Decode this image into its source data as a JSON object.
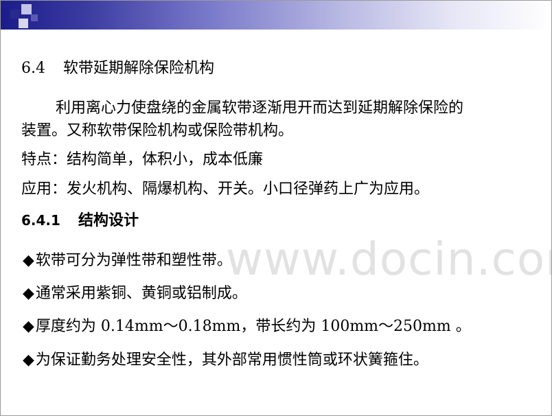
{
  "section": {
    "number": "6.4",
    "title": "软带延期解除保险机构"
  },
  "intro": {
    "line1": "利用离心力使盘绕的金属软带逐渐甩开而达到延期解除保险的",
    "line2": "装置。又称软带保险机构或保险带机构。"
  },
  "features": {
    "label": "特点：",
    "text": "结构简单，体积小，成本低廉"
  },
  "applications": {
    "label": "应用：",
    "text": "发火机构、隔爆机构、开关。小口径弹药上广为应用。"
  },
  "subsection": {
    "number": "6.4.1",
    "title": "结构设计"
  },
  "bullets": [
    {
      "symbol": "◆",
      "text": "软带可分为弹性带和塑性带。"
    },
    {
      "symbol": "◆",
      "text": "通常采用紫铜、黄铜或铝制成。"
    },
    {
      "symbol": "◆",
      "text": "厚度约为 0.14mm～0.18mm，带长约为 100mm～250mm 。"
    },
    {
      "symbol": "◆",
      "text": "为保证勤务处理安全性，其外部常用惯性筒或环状簧箍住。"
    }
  ],
  "watermark": "www.docin.com",
  "colors": {
    "header_dark": "#1c1c8a",
    "header_light": "#ffffff",
    "accent_square": "#2a2a8e",
    "light_square": "#c4c4e8"
  }
}
